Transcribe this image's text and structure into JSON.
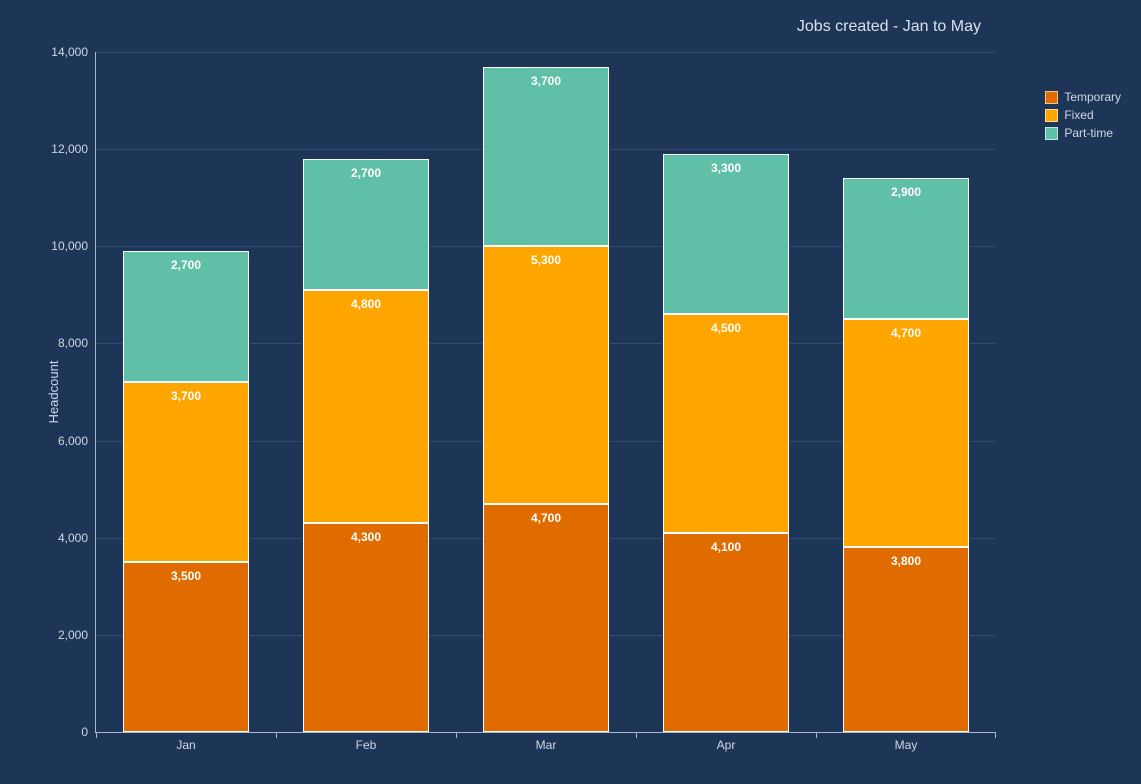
{
  "chart_data": {
    "type": "bar",
    "stacked": true,
    "title": "Jobs created - Jan to May",
    "xlabel": "",
    "ylabel": "Headcount",
    "categories": [
      "Jan",
      "Feb",
      "Mar",
      "Apr",
      "May"
    ],
    "series": [
      {
        "name": "Temporary",
        "color": "#e06c00",
        "values": [
          3500,
          4300,
          4700,
          4100,
          3800
        ]
      },
      {
        "name": "Fixed",
        "color": "#ffa500",
        "values": [
          3700,
          4800,
          5300,
          4500,
          4700
        ]
      },
      {
        "name": "Part-time",
        "color": "#5fc0a7",
        "values": [
          2700,
          2700,
          3700,
          3300,
          2900
        ]
      }
    ],
    "ylim": [
      0,
      14000
    ],
    "yticks": [
      0,
      2000,
      4000,
      6000,
      8000,
      10000,
      12000,
      14000
    ],
    "ytick_labels": [
      "0",
      "2,000",
      "4,000",
      "6,000",
      "8,000",
      "10,000",
      "12,000",
      "14,000"
    ],
    "data_labels": [
      [
        "3,500",
        "3,700",
        "2,700"
      ],
      [
        "4,300",
        "4,800",
        "2,700"
      ],
      [
        "4,700",
        "5,300",
        "3,700"
      ],
      [
        "4,100",
        "4,500",
        "3,300"
      ],
      [
        "3,800",
        "4,700",
        "2,900"
      ]
    ],
    "legend_position": "right"
  }
}
